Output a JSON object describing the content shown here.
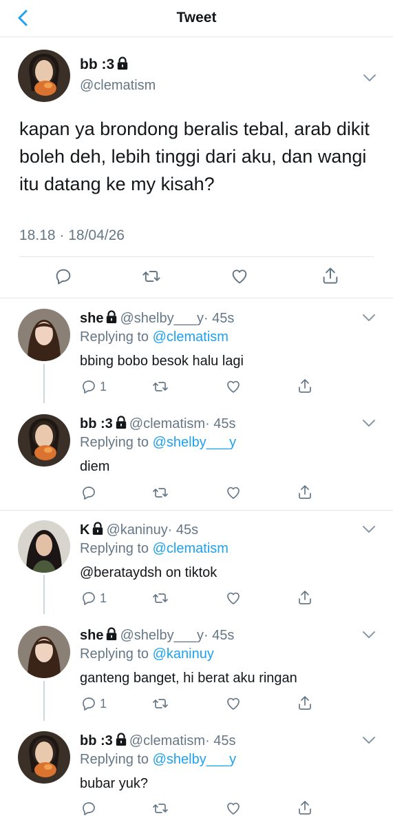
{
  "header": {
    "title": "Tweet",
    "back_icon": "chevron-left-icon",
    "accent": "#1da1f2"
  },
  "main_tweet": {
    "name": "bb :3",
    "handle": "@clematism",
    "text": "kapan ya brondong beralis tebal, arab dikit boleh deh, lebih tinggi dari aku, dan wangi itu datang ke my kisah?",
    "timestamp": "18.18 · 18/04/26",
    "actions": [
      "reply-icon",
      "retweet-icon",
      "like-icon",
      "share-icon"
    ]
  },
  "replies": [
    {
      "name": "she",
      "handle": "@shelby___y",
      "time": "· 45s",
      "replying_label": "Replying to",
      "replying_to": "@clematism",
      "text": "bbing bobo besok halu lagi",
      "reply_count": "1"
    },
    {
      "name": "bb :3",
      "handle": "@clematism",
      "time": "· 45s",
      "replying_label": "Replying to",
      "replying_to": "@shelby___y",
      "text": "diem",
      "reply_count": ""
    },
    {
      "name": "K",
      "handle": "@kaninuy",
      "time": "· 45s",
      "replying_label": "Replying to",
      "replying_to": "@clematism",
      "text": "@berataydsh on tiktok",
      "reply_count": "1"
    },
    {
      "name": "she",
      "handle": "@shelby___y",
      "time": "· 45s",
      "replying_label": "Replying to",
      "replying_to": "@kaninuy",
      "text": "ganteng banget, hi berat aku ringan",
      "reply_count": "1"
    },
    {
      "name": "bb :3",
      "handle": "@clematism",
      "time": "· 45s",
      "replying_label": "Replying to",
      "replying_to": "@shelby___y",
      "text": "bubar yuk?",
      "reply_count": ""
    }
  ]
}
